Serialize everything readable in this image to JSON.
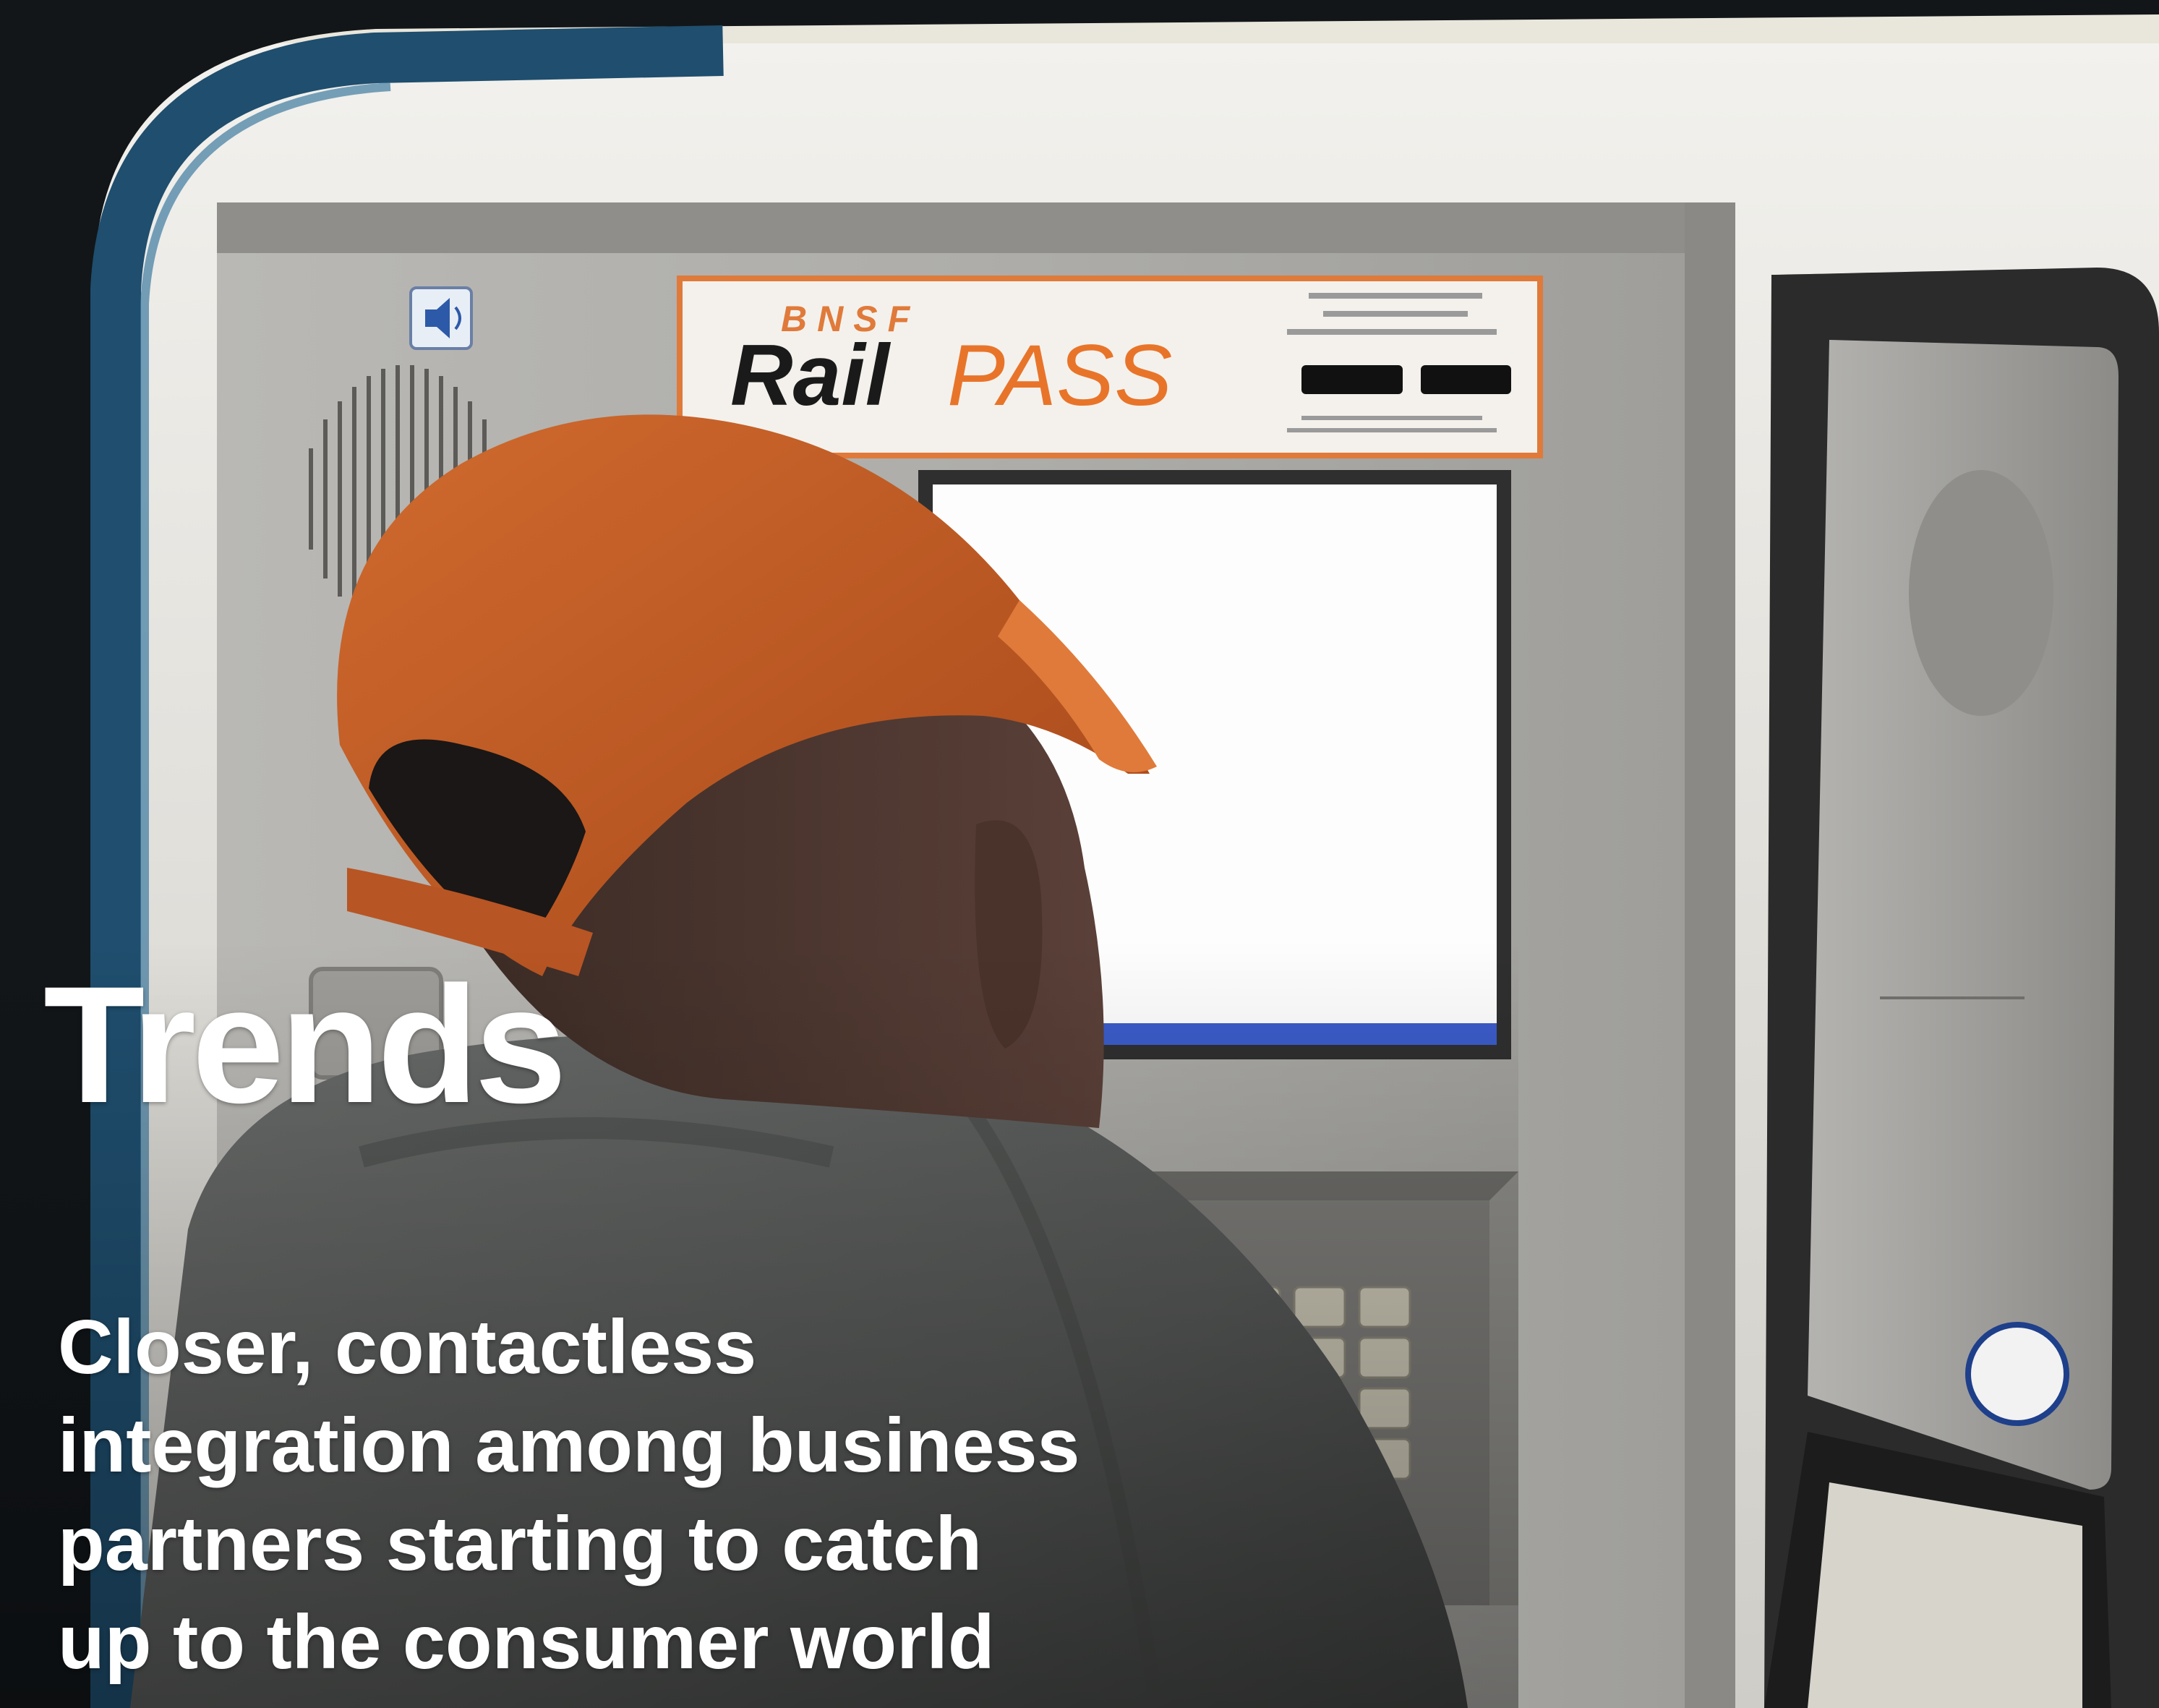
{
  "slide": {
    "title": "Trends",
    "subtitle_lines": [
      "Closer, contactless",
      "integration among business",
      "partners starting to catch",
      "up to the consumer world"
    ]
  },
  "photo": {
    "kiosk_logo_brand": "BNSF",
    "kiosk_logo_name_part1": "Rail",
    "kiosk_logo_name_part2": "PASS"
  },
  "colors": {
    "title_text": "#ffffff",
    "cap_orange": "#c2571e",
    "kiosk_gray": "#a9a8a5",
    "door_frame_blue": "#1f4e6e",
    "logo_orange": "#e8742a"
  }
}
